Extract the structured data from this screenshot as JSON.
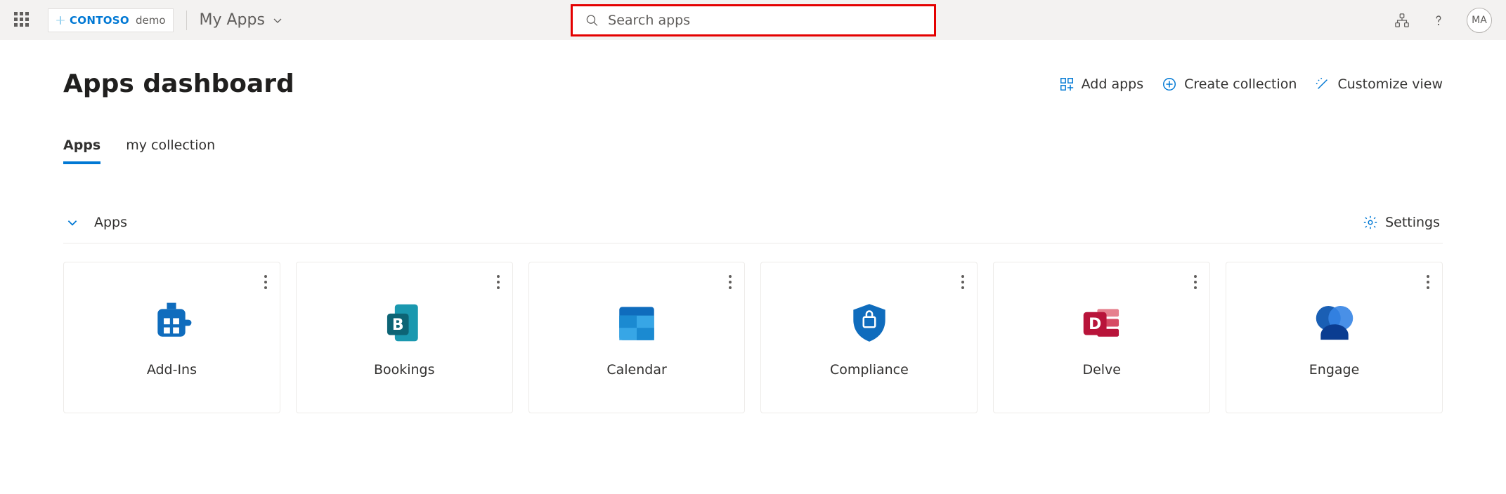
{
  "header": {
    "brand": "CONTOSO",
    "brandSuffix": "demo",
    "nav": "My Apps",
    "searchPlaceholder": "Search apps",
    "avatar": "MA"
  },
  "page": {
    "title": "Apps dashboard",
    "actions": {
      "add": "Add apps",
      "create": "Create collection",
      "customize": "Customize view"
    },
    "tabs": [
      "Apps",
      "my collection"
    ],
    "section": "Apps",
    "settings": "Settings",
    "tiles": [
      {
        "label": "Add-Ins"
      },
      {
        "label": "Bookings"
      },
      {
        "label": "Calendar"
      },
      {
        "label": "Compliance"
      },
      {
        "label": "Delve"
      },
      {
        "label": "Engage"
      }
    ]
  }
}
